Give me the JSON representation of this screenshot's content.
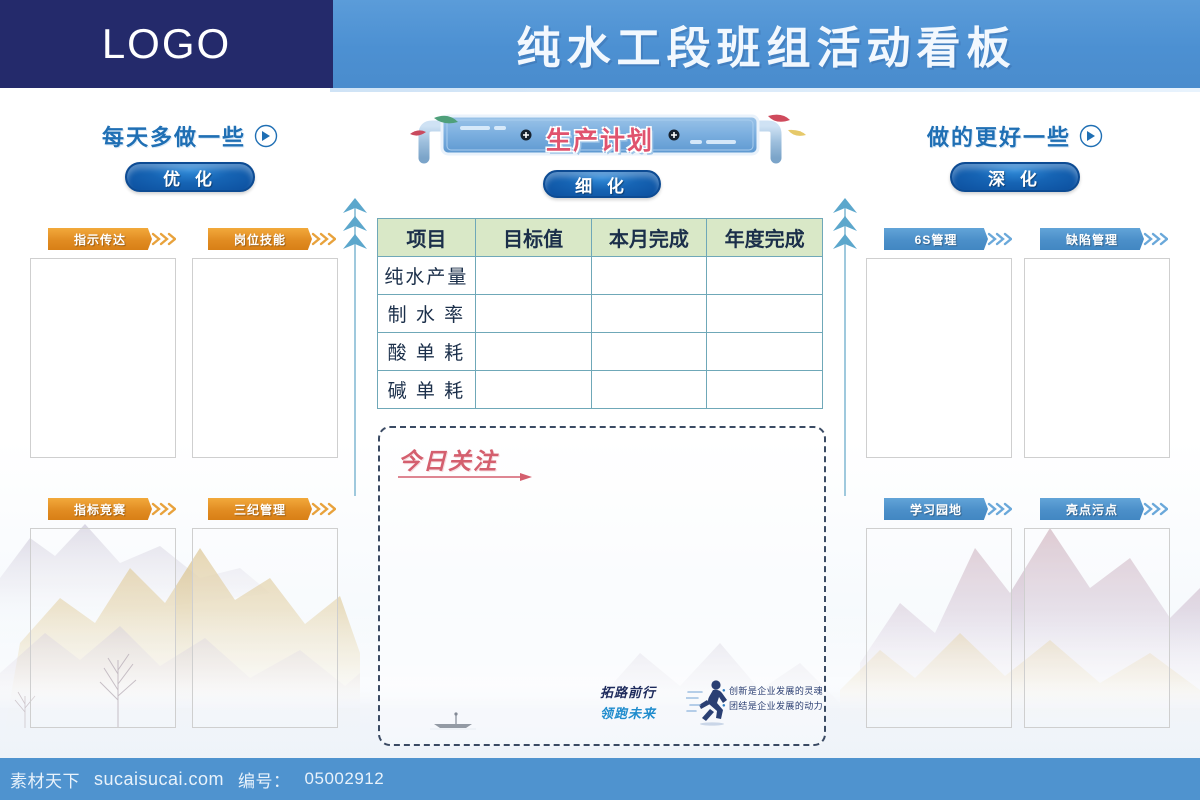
{
  "header": {
    "logo_text": "LOGO",
    "title": "纯水工段班组活动看板",
    "logo_bg": "#242a6b",
    "title_bg": "#4f94d4"
  },
  "slogans": {
    "left": {
      "text": "每天多做一些",
      "badge": "优 化",
      "arrow_icon": "arrow-right-circle-icon"
    },
    "right": {
      "text": "做的更好一些",
      "badge": "深 化",
      "arrow_icon": "arrow-right-circle-icon"
    }
  },
  "center": {
    "banner_title": "生产计划",
    "badge": "细 化"
  },
  "plan_table": {
    "columns": [
      "项目",
      "目标值",
      "本月完成",
      "年度完成"
    ],
    "rows": [
      {
        "item": "纯水产量",
        "target": "",
        "month": "",
        "year": ""
      },
      {
        "item": "制 水 率",
        "target": "",
        "month": "",
        "year": ""
      },
      {
        "item": "酸 单 耗",
        "target": "",
        "month": "",
        "year": ""
      },
      {
        "item": "碱 单 耗",
        "target": "",
        "month": "",
        "year": ""
      }
    ],
    "header_bg": "#d9e8c7",
    "border_color": "#6fa8b8"
  },
  "focus": {
    "title": "今日关注"
  },
  "motto": {
    "line1": "拓路前行",
    "line2": "领跑未来",
    "bullet1": "创新是企业发展的灵魂",
    "bullet2": "团结是企业发展的动力"
  },
  "left_tags": [
    {
      "label": "指示传达",
      "color": "#e18c22"
    },
    {
      "label": "岗位技能",
      "color": "#e18c22"
    },
    {
      "label": "指标竞赛",
      "color": "#e18c22"
    },
    {
      "label": "三纪管理",
      "color": "#e18c22"
    }
  ],
  "right_tags": [
    {
      "label": "6S管理",
      "color": "#4b8fc9"
    },
    {
      "label": "缺陷管理",
      "color": "#4b8fc9"
    },
    {
      "label": "学习园地",
      "color": "#4b8fc9"
    },
    {
      "label": "亮点污点",
      "color": "#4b8fc9"
    }
  ],
  "footer": {
    "brand": "素材天下",
    "site": "sucaisucai.com",
    "id_label": "编号：",
    "id_value": "05002912"
  }
}
